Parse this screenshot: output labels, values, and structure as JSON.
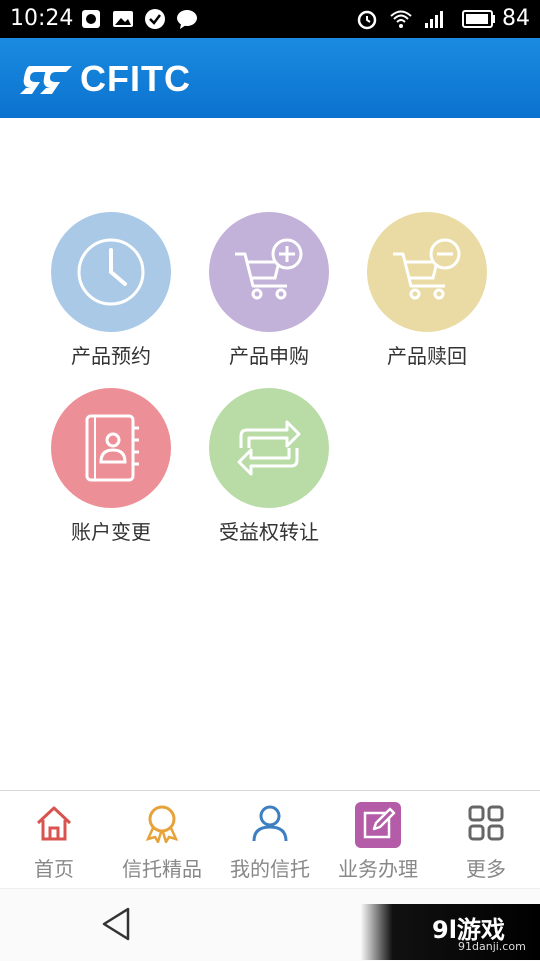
{
  "status_bar": {
    "time": "10:24",
    "battery": "84"
  },
  "header": {
    "logo_text": "CFITC"
  },
  "grid": [
    {
      "label": "产品预约",
      "icon": "clock-icon",
      "color": "#a9c9e6"
    },
    {
      "label": "产品申购",
      "icon": "cart-add-icon",
      "color": "#c2b1d8"
    },
    {
      "label": "产品赎回",
      "icon": "cart-remove-icon",
      "color": "#e9dba3"
    },
    {
      "label": "账户变更",
      "icon": "address-book-icon",
      "color": "#ec8f96"
    },
    {
      "label": "受益权转让",
      "icon": "transfer-arrows-icon",
      "color": "#b9dca7"
    }
  ],
  "tabs": [
    {
      "label": "首页",
      "icon": "home-icon"
    },
    {
      "label": "信托精品",
      "icon": "medal-icon"
    },
    {
      "label": "我的信托",
      "icon": "user-icon"
    },
    {
      "label": "业务办理",
      "icon": "edit-icon",
      "selected": true
    },
    {
      "label": "更多",
      "icon": "grid-icon"
    }
  ],
  "watermark": {
    "main": "9l游戏",
    "sub": "91danji.com"
  }
}
